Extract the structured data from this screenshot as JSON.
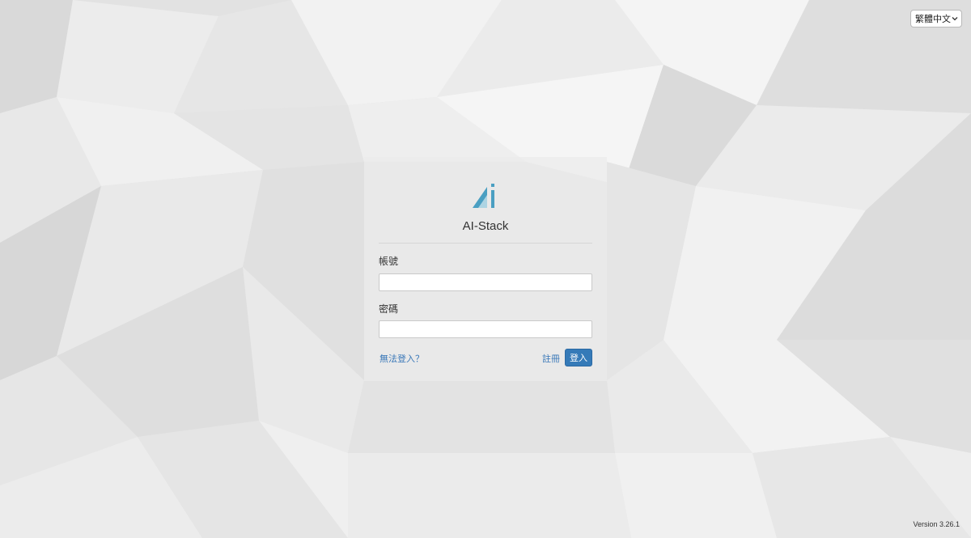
{
  "language_select": {
    "selected": "繁體中文",
    "icon": "chevron-down-icon"
  },
  "login": {
    "app_name": "AI-Stack",
    "logo_icon": "ai-stack-logo",
    "account_label": "帳號",
    "account_value": "",
    "password_label": "密碼",
    "password_value": "",
    "cant_login_link": "無法登入？",
    "register_link": "註冊",
    "login_button": "登入"
  },
  "footer": {
    "version": "Version 3.26.1"
  },
  "colors": {
    "accent": "#357ab8",
    "link": "#3a78b8",
    "logo": "#4a9fc2"
  }
}
